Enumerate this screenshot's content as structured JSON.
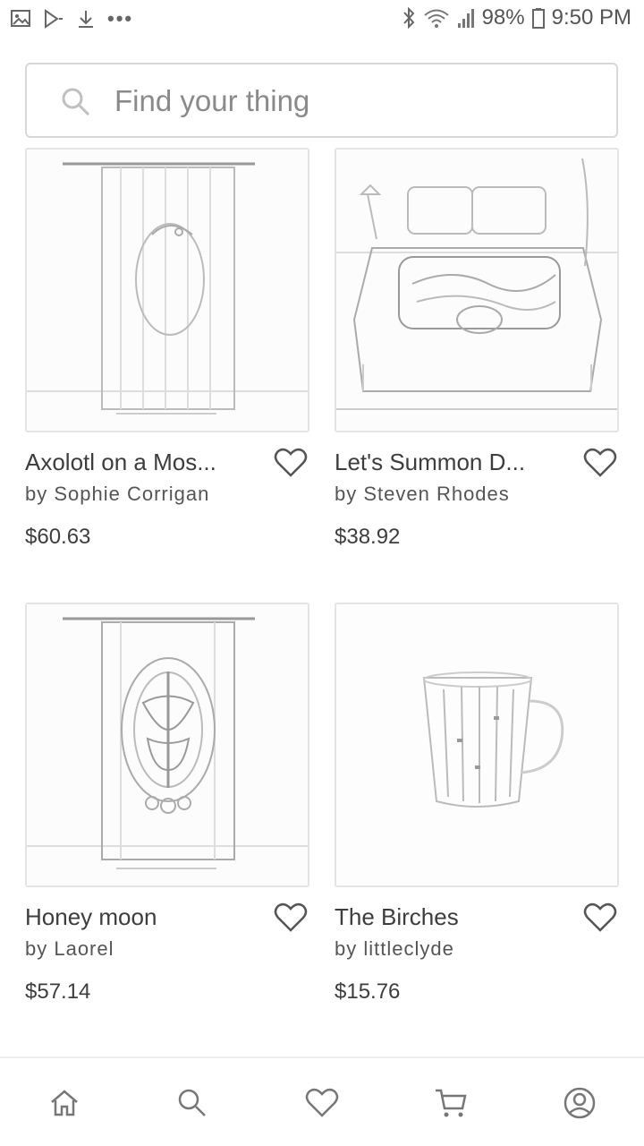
{
  "status_bar": {
    "battery": "98%",
    "time": "9:50 PM",
    "left_icons": [
      "gallery-icon",
      "play-store-icon",
      "download-icon",
      "more-dots-icon"
    ],
    "right_icons": [
      "bluetooth-icon",
      "wifi-icon",
      "signal-icon",
      "battery-icon"
    ]
  },
  "search": {
    "placeholder": "Find your thing",
    "value": ""
  },
  "products": [
    {
      "title": "Axolotl on a Mos...",
      "artist": "by Sophie Corrigan",
      "price": "$60.63",
      "image": "shower-curtain-axolotl"
    },
    {
      "title": "Let's Summon D...",
      "artist": "by Steven Rhodes",
      "price": "$38.92",
      "image": "bedding-duvet"
    },
    {
      "title": "Honey moon",
      "artist": "by Laorel",
      "price": "$57.14",
      "image": "shower-curtain-honeymoon"
    },
    {
      "title": "The Birches",
      "artist": "by littleclyde",
      "price": "$15.76",
      "image": "mug-birches"
    }
  ],
  "bottom_nav": {
    "items": [
      "home-icon",
      "search-icon",
      "heart-icon",
      "cart-icon",
      "account-icon"
    ]
  },
  "colors": {
    "text": "#3d3d3d",
    "border": "#d8d8d8",
    "icon": "#777777"
  }
}
